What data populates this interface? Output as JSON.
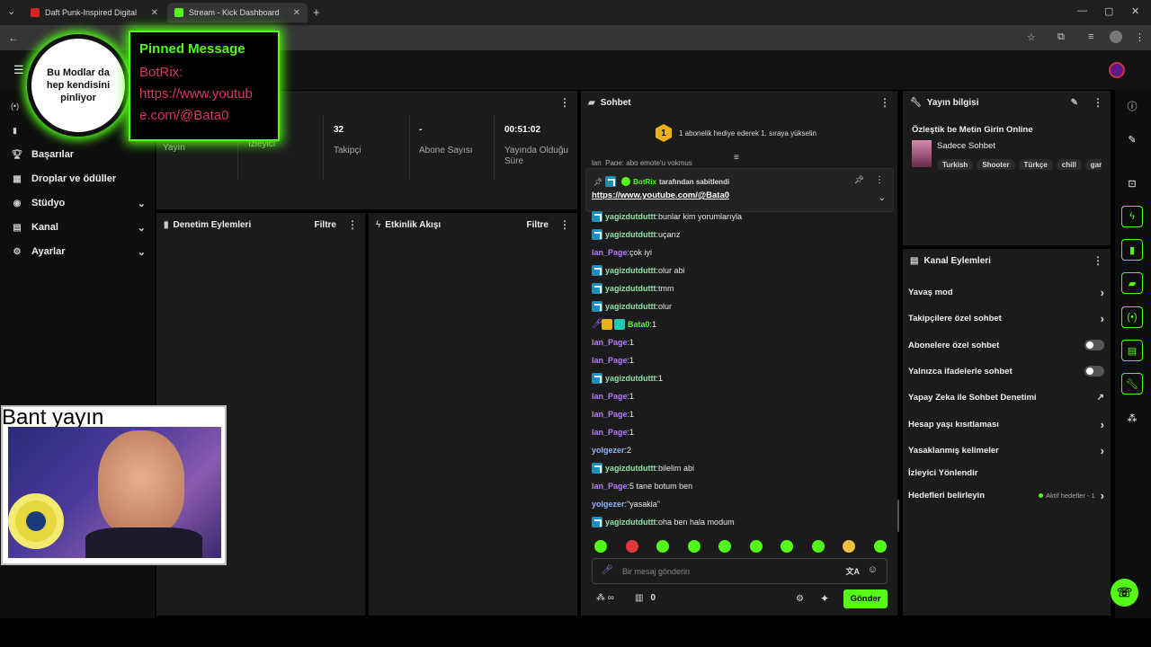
{
  "browser": {
    "tabs": [
      {
        "title": "Daft Punk-Inspired Digital",
        "active": false
      },
      {
        "title": "Stream - Kick Dashboard",
        "active": true
      }
    ],
    "new_tab": "+",
    "window_controls": [
      "—",
      "▢",
      "✕"
    ]
  },
  "overlay": {
    "circle_text": "Bu Modlar da hep kendisini pinliyor",
    "pinned_title": "Pinned Message",
    "pinned_user": "BotRix:",
    "pinned_link": "https://www.youtube.com/@Bata0",
    "pinned_link_lines": [
      "https://www.youtub",
      "e.com/@Bata0"
    ],
    "webcam_label": "Bant yayın"
  },
  "sidebar": {
    "items": [
      {
        "label": "Başarılar",
        "icon": "trophy-icon",
        "chevron": false
      },
      {
        "label": "Droplar ve ödüller",
        "icon": "gift-icon",
        "chevron": false
      },
      {
        "label": "Stüdyo",
        "icon": "studio-icon",
        "chevron": true
      },
      {
        "label": "Kanal",
        "icon": "channel-icon",
        "chevron": true
      },
      {
        "label": "Ayarlar",
        "icon": "gear-icon",
        "chevron": true
      }
    ]
  },
  "stats": [
    {
      "value": "",
      "label": "Yayın"
    },
    {
      "value": "",
      "label": "İzleyici"
    },
    {
      "value": "32",
      "label": "Takipçi"
    },
    {
      "value": "-",
      "label": "Abone Sayısı"
    },
    {
      "value": "00:51:02",
      "label": "Yayında Olduğu Süre"
    }
  ],
  "panels": {
    "moderation": {
      "title": "Denetim Eylemleri",
      "filter": "Filtre"
    },
    "activity": {
      "title": "Etkinlik Akışı",
      "filter": "Filtre"
    }
  },
  "chat": {
    "title": "Sohbet",
    "goal_number": "1",
    "goal_text": "1 abonelik hediye ederek 1. sıraya yükselin",
    "partial_line": "lan_Page: abo emote'u yokmuş",
    "pinned": {
      "by_user": "BotRix",
      "by_text": "tarafından sabitlendi",
      "link": "https://www.youtube.com/@Bata0"
    },
    "messages": [
      {
        "user": "yagizdutduttt",
        "text": "bunlar kim yorumlarıyla",
        "color": "#8fe3a6",
        "badge": true
      },
      {
        "user": "yagizdutduttt",
        "text": "uçarız",
        "color": "#8fe3a6",
        "badge": true
      },
      {
        "user": "lan_Page",
        "text": "çok iyi",
        "color": "#b57cff",
        "badge": false
      },
      {
        "user": "yagizdutduttt",
        "text": "olur abi",
        "color": "#8fe3a6",
        "badge": true
      },
      {
        "user": "yagizdutduttt",
        "text": "tmm",
        "color": "#8fe3a6",
        "badge": true
      },
      {
        "user": "yagizdutduttt",
        "text": "olur",
        "color": "#8fe3a6",
        "badge": true
      },
      {
        "user": "Bata0",
        "text": "1",
        "color": "#53fc18",
        "badge": false,
        "host": true
      },
      {
        "user": "lan_Page",
        "text": "1",
        "color": "#b57cff",
        "badge": false
      },
      {
        "user": "lan_Page",
        "text": "1",
        "color": "#b57cff",
        "badge": false
      },
      {
        "user": "yagizdutduttt",
        "text": "1",
        "color": "#8fe3a6",
        "badge": true
      },
      {
        "user": "lan_Page",
        "text": "1",
        "color": "#b57cff",
        "badge": false
      },
      {
        "user": "lan_Page",
        "text": "1",
        "color": "#b57cff",
        "badge": false
      },
      {
        "user": "lan_Page",
        "text": "1",
        "color": "#b57cff",
        "badge": false
      },
      {
        "user": "yolgezer",
        "text": "2",
        "color": "#8fb5ff",
        "badge": false
      },
      {
        "user": "yagizdutduttt",
        "text": "bilelim abi",
        "color": "#8fe3a6",
        "badge": true
      },
      {
        "user": "lan_Page",
        "text": "5 tane botum ben",
        "color": "#b57cff",
        "badge": false
      },
      {
        "user": "yolgezer",
        "text": "\"yasakla\"",
        "color": "#8fb5ff",
        "badge": false
      },
      {
        "user": "yagizdutduttt",
        "text": "oha ben hala modum",
        "color": "#8fe3a6",
        "badge": true
      }
    ],
    "input_placeholder": "Bir mesaj gönderin",
    "points": "0",
    "send_label": "Gönder"
  },
  "stream_info": {
    "title": "Yayın bilgisi",
    "stream_title": "Özleştik be Metin Girin Online",
    "category": "Sadece Sohbet",
    "tags": [
      "Turkish",
      "Shooter",
      "Türkçe",
      "chill",
      "gar"
    ]
  },
  "channel_actions": {
    "title": "Kanal Eylemleri",
    "items": [
      {
        "label": "Yavaş mod",
        "kind": "chevron"
      },
      {
        "label": "Takipçilere özel sohbet",
        "kind": "chevron"
      },
      {
        "label": "Abonelere özel sohbet",
        "kind": "toggle"
      },
      {
        "label": "Yalnızca ifadelerle sohbet",
        "kind": "toggle"
      },
      {
        "label": "Yapay Zeka ile Sohbet Denetimi",
        "kind": "external"
      },
      {
        "label": "Hesap yaşı kısıtlaması",
        "kind": "chevron"
      },
      {
        "label": "Yasaklanmış kelimeler",
        "kind": "chevron"
      },
      {
        "label": "İzleyici Yönlendir",
        "kind": "none"
      },
      {
        "label": "Hedefleri belirleyin",
        "kind": "chevron",
        "status": "Aktif hedefler - 1"
      }
    ]
  },
  "colors": {
    "accent": "#53fc18",
    "panel": "#1b1b1b",
    "bg": "#000000"
  }
}
